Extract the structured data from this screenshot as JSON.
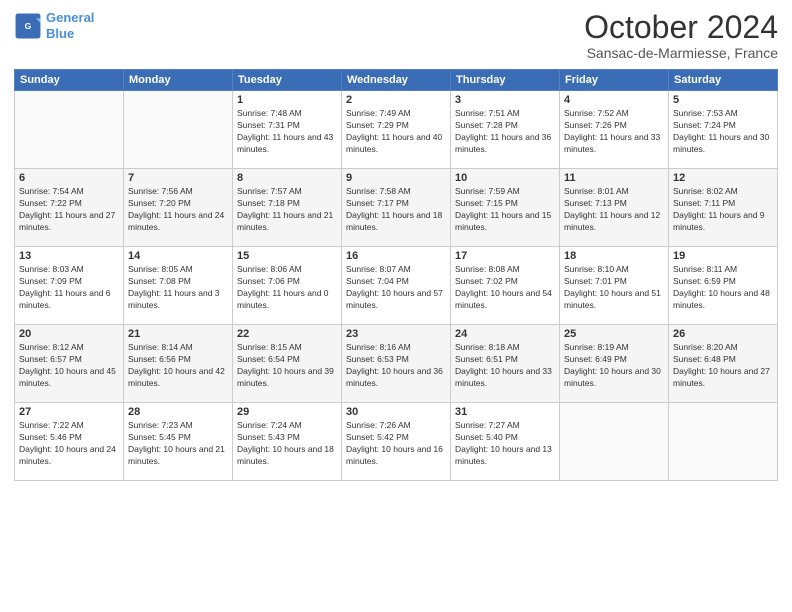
{
  "header": {
    "logo_line1": "General",
    "logo_line2": "Blue",
    "month_title": "October 2024",
    "subtitle": "Sansac-de-Marmiesse, France"
  },
  "days_header": [
    "Sunday",
    "Monday",
    "Tuesday",
    "Wednesday",
    "Thursday",
    "Friday",
    "Saturday"
  ],
  "weeks": [
    [
      {
        "day": "",
        "info": ""
      },
      {
        "day": "",
        "info": ""
      },
      {
        "day": "1",
        "info": "Sunrise: 7:48 AM\nSunset: 7:31 PM\nDaylight: 11 hours and 43 minutes."
      },
      {
        "day": "2",
        "info": "Sunrise: 7:49 AM\nSunset: 7:29 PM\nDaylight: 11 hours and 40 minutes."
      },
      {
        "day": "3",
        "info": "Sunrise: 7:51 AM\nSunset: 7:28 PM\nDaylight: 11 hours and 36 minutes."
      },
      {
        "day": "4",
        "info": "Sunrise: 7:52 AM\nSunset: 7:26 PM\nDaylight: 11 hours and 33 minutes."
      },
      {
        "day": "5",
        "info": "Sunrise: 7:53 AM\nSunset: 7:24 PM\nDaylight: 11 hours and 30 minutes."
      }
    ],
    [
      {
        "day": "6",
        "info": "Sunrise: 7:54 AM\nSunset: 7:22 PM\nDaylight: 11 hours and 27 minutes."
      },
      {
        "day": "7",
        "info": "Sunrise: 7:56 AM\nSunset: 7:20 PM\nDaylight: 11 hours and 24 minutes."
      },
      {
        "day": "8",
        "info": "Sunrise: 7:57 AM\nSunset: 7:18 PM\nDaylight: 11 hours and 21 minutes."
      },
      {
        "day": "9",
        "info": "Sunrise: 7:58 AM\nSunset: 7:17 PM\nDaylight: 11 hours and 18 minutes."
      },
      {
        "day": "10",
        "info": "Sunrise: 7:59 AM\nSunset: 7:15 PM\nDaylight: 11 hours and 15 minutes."
      },
      {
        "day": "11",
        "info": "Sunrise: 8:01 AM\nSunset: 7:13 PM\nDaylight: 11 hours and 12 minutes."
      },
      {
        "day": "12",
        "info": "Sunrise: 8:02 AM\nSunset: 7:11 PM\nDaylight: 11 hours and 9 minutes."
      }
    ],
    [
      {
        "day": "13",
        "info": "Sunrise: 8:03 AM\nSunset: 7:09 PM\nDaylight: 11 hours and 6 minutes."
      },
      {
        "day": "14",
        "info": "Sunrise: 8:05 AM\nSunset: 7:08 PM\nDaylight: 11 hours and 3 minutes."
      },
      {
        "day": "15",
        "info": "Sunrise: 8:06 AM\nSunset: 7:06 PM\nDaylight: 11 hours and 0 minutes."
      },
      {
        "day": "16",
        "info": "Sunrise: 8:07 AM\nSunset: 7:04 PM\nDaylight: 10 hours and 57 minutes."
      },
      {
        "day": "17",
        "info": "Sunrise: 8:08 AM\nSunset: 7:02 PM\nDaylight: 10 hours and 54 minutes."
      },
      {
        "day": "18",
        "info": "Sunrise: 8:10 AM\nSunset: 7:01 PM\nDaylight: 10 hours and 51 minutes."
      },
      {
        "day": "19",
        "info": "Sunrise: 8:11 AM\nSunset: 6:59 PM\nDaylight: 10 hours and 48 minutes."
      }
    ],
    [
      {
        "day": "20",
        "info": "Sunrise: 8:12 AM\nSunset: 6:57 PM\nDaylight: 10 hours and 45 minutes."
      },
      {
        "day": "21",
        "info": "Sunrise: 8:14 AM\nSunset: 6:56 PM\nDaylight: 10 hours and 42 minutes."
      },
      {
        "day": "22",
        "info": "Sunrise: 8:15 AM\nSunset: 6:54 PM\nDaylight: 10 hours and 39 minutes."
      },
      {
        "day": "23",
        "info": "Sunrise: 8:16 AM\nSunset: 6:53 PM\nDaylight: 10 hours and 36 minutes."
      },
      {
        "day": "24",
        "info": "Sunrise: 8:18 AM\nSunset: 6:51 PM\nDaylight: 10 hours and 33 minutes."
      },
      {
        "day": "25",
        "info": "Sunrise: 8:19 AM\nSunset: 6:49 PM\nDaylight: 10 hours and 30 minutes."
      },
      {
        "day": "26",
        "info": "Sunrise: 8:20 AM\nSunset: 6:48 PM\nDaylight: 10 hours and 27 minutes."
      }
    ],
    [
      {
        "day": "27",
        "info": "Sunrise: 7:22 AM\nSunset: 5:46 PM\nDaylight: 10 hours and 24 minutes."
      },
      {
        "day": "28",
        "info": "Sunrise: 7:23 AM\nSunset: 5:45 PM\nDaylight: 10 hours and 21 minutes."
      },
      {
        "day": "29",
        "info": "Sunrise: 7:24 AM\nSunset: 5:43 PM\nDaylight: 10 hours and 18 minutes."
      },
      {
        "day": "30",
        "info": "Sunrise: 7:26 AM\nSunset: 5:42 PM\nDaylight: 10 hours and 16 minutes."
      },
      {
        "day": "31",
        "info": "Sunrise: 7:27 AM\nSunset: 5:40 PM\nDaylight: 10 hours and 13 minutes."
      },
      {
        "day": "",
        "info": ""
      },
      {
        "day": "",
        "info": ""
      }
    ]
  ]
}
